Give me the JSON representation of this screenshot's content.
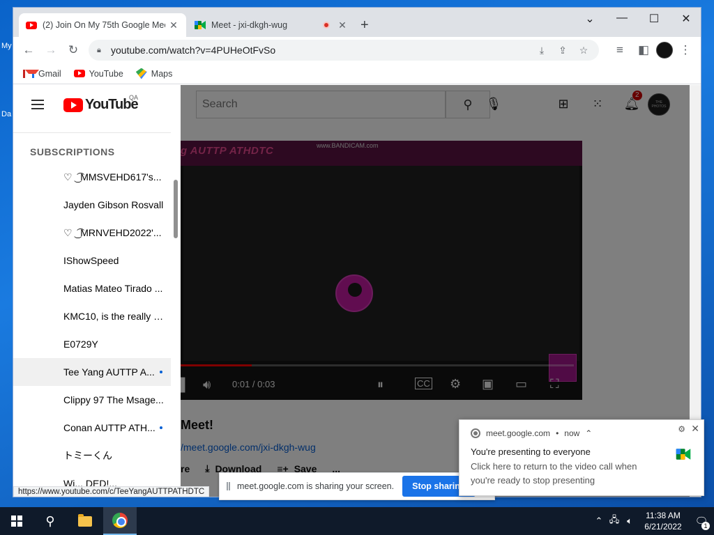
{
  "desktop": {
    "left_fragments": [
      "My",
      "Da"
    ]
  },
  "browser": {
    "tabs": [
      {
        "title": "(2) Join On My 75th Google Mee",
        "icon": "youtube-icon",
        "active": true
      },
      {
        "title": "Meet - jxi-dkgh-wug",
        "icon": "google-meet-icon",
        "active": false,
        "recording": true
      }
    ],
    "new_tab_label": "+",
    "window_controls": {
      "tab_search": "⌄",
      "minimize": "—",
      "maximize": "☐",
      "close": "✕"
    },
    "url": "youtube.com/watch?v=4PUHeOtFvSo",
    "bookmarks": [
      {
        "label": "Gmail",
        "icon": "gmail-icon"
      },
      {
        "label": "YouTube",
        "icon": "youtube-icon"
      },
      {
        "label": "Maps",
        "icon": "maps-icon"
      }
    ],
    "status_url": "https://www.youtube.com/c/TeeYangAUTTPATHDTC"
  },
  "youtube": {
    "logo_text": "YouTube",
    "logo_badge": "QA",
    "search_placeholder": "Search",
    "notification_count": "2",
    "avatar_text": "THE PHOTOS",
    "sidebar": {
      "section_title": "SUBSCRIPTIONS",
      "items": [
        {
          "label": "♡ ͜ ͡ MMSVEHD617's...",
          "new": false
        },
        {
          "label": "Jayden Gibson Rosvall",
          "new": false
        },
        {
          "label": "♡ ͜ ͡ MRNVEHD2022'...",
          "new": false
        },
        {
          "label": "IShowSpeed",
          "new": false
        },
        {
          "label": "Matias Mateo Tirado ...",
          "new": false
        },
        {
          "label": "KMC10, is the really b...",
          "new": false
        },
        {
          "label": "E0729Y",
          "new": false
        },
        {
          "label": "Tee Yang AUTTP A...",
          "new": true,
          "highlighted": true
        },
        {
          "label": "Clippy 97 The Msage...",
          "new": false
        },
        {
          "label": "Conan AUTTP ATH...",
          "new": true
        },
        {
          "label": "トミーくん",
          "new": false
        },
        {
          "label": "Wi... DED!...",
          "new": false
        }
      ]
    },
    "video": {
      "overlay_title": "g AUTTP ATHDTC",
      "overlay_watermark": "www.BANDICAM.com",
      "time": "0:01 / 0:03",
      "progress_fraction": 0.18
    },
    "below": {
      "title_fragment": "Meet!",
      "link_fragment": "/meet.google.com/jxi-dkgh-wug",
      "actions": {
        "share_fragment": "re",
        "download": "Download",
        "save": "Save",
        "more": "..."
      }
    }
  },
  "sharing_bar": {
    "text": "meet.google.com is sharing your screen.",
    "button": "Stop sharing"
  },
  "toast": {
    "source": "meet.google.com",
    "separator": "•",
    "time": "now",
    "title": "You're presenting to everyone",
    "body": "Click here to return to the video call when you're ready to stop presenting"
  },
  "taskbar": {
    "time": "11:38 AM",
    "date": "6/21/2022",
    "notification_count": "1"
  },
  "colors": {
    "youtube_red": "#ff0000",
    "chrome_blue": "#1a73e8",
    "taskbar": "#0f1a2a"
  }
}
